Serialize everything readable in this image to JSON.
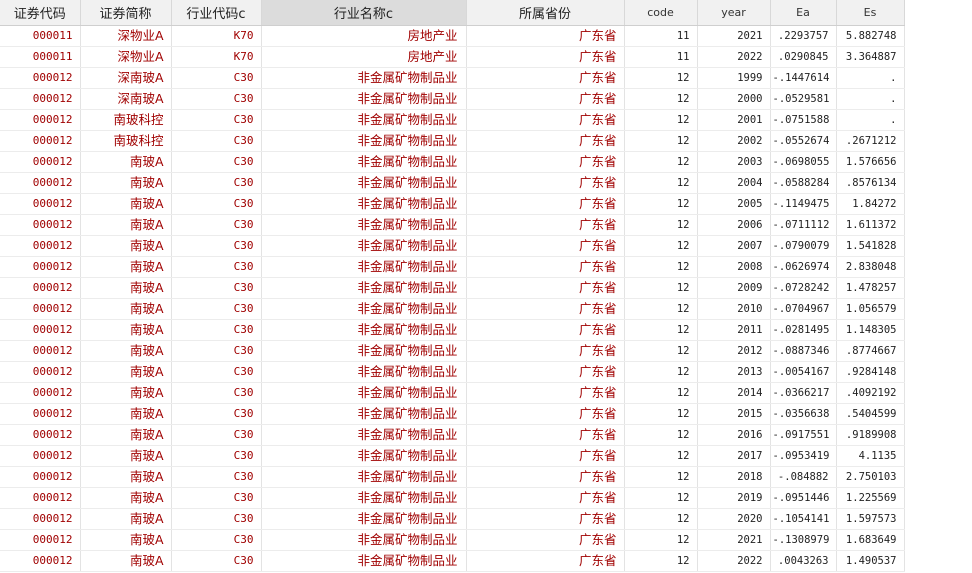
{
  "columns": [
    {
      "label": "证券代码",
      "type": "str",
      "font": "mono"
    },
    {
      "label": "证券简称",
      "type": "str",
      "font": "cjk"
    },
    {
      "label": "行业代码c",
      "type": "str",
      "font": "mono"
    },
    {
      "label": "行业名称c",
      "type": "str",
      "font": "cjk",
      "selected": true
    },
    {
      "label": "所属省份",
      "type": "str",
      "font": "cjk"
    },
    {
      "label": "code",
      "type": "num"
    },
    {
      "label": "year",
      "type": "num"
    },
    {
      "label": "Ea",
      "type": "num"
    },
    {
      "label": "Es",
      "type": "num"
    }
  ],
  "rows": [
    [
      "000011",
      "深物业A",
      "K70",
      "房地产业",
      "广东省",
      "11",
      "2021",
      ".2293757",
      "5.882748"
    ],
    [
      "000011",
      "深物业A",
      "K70",
      "房地产业",
      "广东省",
      "11",
      "2022",
      ".0290845",
      "3.364887"
    ],
    [
      "000012",
      "深南玻A",
      "C30",
      "非金属矿物制品业",
      "广东省",
      "12",
      "1999",
      "-.1447614",
      "."
    ],
    [
      "000012",
      "深南玻A",
      "C30",
      "非金属矿物制品业",
      "广东省",
      "12",
      "2000",
      "-.0529581",
      "."
    ],
    [
      "000012",
      "南玻科控",
      "C30",
      "非金属矿物制品业",
      "广东省",
      "12",
      "2001",
      "-.0751588",
      "."
    ],
    [
      "000012",
      "南玻科控",
      "C30",
      "非金属矿物制品业",
      "广东省",
      "12",
      "2002",
      "-.0552674",
      ".2671212"
    ],
    [
      "000012",
      "南玻A",
      "C30",
      "非金属矿物制品业",
      "广东省",
      "12",
      "2003",
      "-.0698055",
      "1.576656"
    ],
    [
      "000012",
      "南玻A",
      "C30",
      "非金属矿物制品业",
      "广东省",
      "12",
      "2004",
      "-.0588284",
      ".8576134"
    ],
    [
      "000012",
      "南玻A",
      "C30",
      "非金属矿物制品业",
      "广东省",
      "12",
      "2005",
      "-.1149475",
      "1.84272"
    ],
    [
      "000012",
      "南玻A",
      "C30",
      "非金属矿物制品业",
      "广东省",
      "12",
      "2006",
      "-.0711112",
      "1.611372"
    ],
    [
      "000012",
      "南玻A",
      "C30",
      "非金属矿物制品业",
      "广东省",
      "12",
      "2007",
      "-.0790079",
      "1.541828"
    ],
    [
      "000012",
      "南玻A",
      "C30",
      "非金属矿物制品业",
      "广东省",
      "12",
      "2008",
      "-.0626974",
      "2.838048"
    ],
    [
      "000012",
      "南玻A",
      "C30",
      "非金属矿物制品业",
      "广东省",
      "12",
      "2009",
      "-.0728242",
      "1.478257"
    ],
    [
      "000012",
      "南玻A",
      "C30",
      "非金属矿物制品业",
      "广东省",
      "12",
      "2010",
      "-.0704967",
      "1.056579"
    ],
    [
      "000012",
      "南玻A",
      "C30",
      "非金属矿物制品业",
      "广东省",
      "12",
      "2011",
      "-.0281495",
      "1.148305"
    ],
    [
      "000012",
      "南玻A",
      "C30",
      "非金属矿物制品业",
      "广东省",
      "12",
      "2012",
      "-.0887346",
      ".8774667"
    ],
    [
      "000012",
      "南玻A",
      "C30",
      "非金属矿物制品业",
      "广东省",
      "12",
      "2013",
      "-.0054167",
      ".9284148"
    ],
    [
      "000012",
      "南玻A",
      "C30",
      "非金属矿物制品业",
      "广东省",
      "12",
      "2014",
      "-.0366217",
      ".4092192"
    ],
    [
      "000012",
      "南玻A",
      "C30",
      "非金属矿物制品业",
      "广东省",
      "12",
      "2015",
      "-.0356638",
      ".5404599"
    ],
    [
      "000012",
      "南玻A",
      "C30",
      "非金属矿物制品业",
      "广东省",
      "12",
      "2016",
      "-.0917551",
      ".9189908"
    ],
    [
      "000012",
      "南玻A",
      "C30",
      "非金属矿物制品业",
      "广东省",
      "12",
      "2017",
      "-.0953419",
      "4.1135"
    ],
    [
      "000012",
      "南玻A",
      "C30",
      "非金属矿物制品业",
      "广东省",
      "12",
      "2018",
      "-.084882",
      "2.750103"
    ],
    [
      "000012",
      "南玻A",
      "C30",
      "非金属矿物制品业",
      "广东省",
      "12",
      "2019",
      "-.0951446",
      "1.225569"
    ],
    [
      "000012",
      "南玻A",
      "C30",
      "非金属矿物制品业",
      "广东省",
      "12",
      "2020",
      "-.1054141",
      "1.597573"
    ],
    [
      "000012",
      "南玻A",
      "C30",
      "非金属矿物制品业",
      "广东省",
      "12",
      "2021",
      "-.1308979",
      "1.683649"
    ],
    [
      "000012",
      "南玻A",
      "C30",
      "非金属矿物制品业",
      "广东省",
      "12",
      "2022",
      ".0043263",
      "1.490537"
    ]
  ],
  "colors": {
    "string_text": "#a00000",
    "numeric_text": "#222222",
    "header_bg": "#f1f1f1",
    "selected_header_bg": "#dcdcdc",
    "grid_line": "#e3e3e3"
  }
}
